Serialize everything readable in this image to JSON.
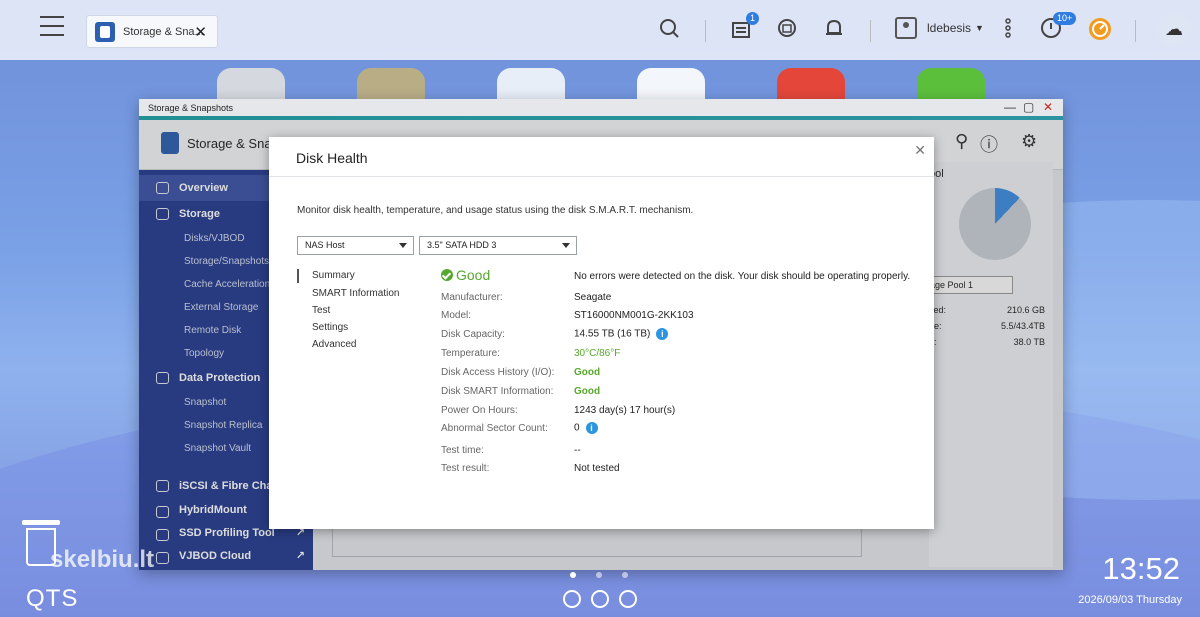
{
  "topbar": {
    "task_tab_label": "Storage & Sna...",
    "notification_count": "1",
    "events_count": "10+",
    "user_name": "ldebesis"
  },
  "window": {
    "title": "Storage & Snapshots",
    "app_title": "Storage & Snapshots"
  },
  "sidebar": {
    "overview": "Overview",
    "storage": "Storage",
    "storage_items": [
      "Disks/VJBOD",
      "Storage/Snapshots",
      "Cache Acceleration",
      "External Storage",
      "Remote Disk",
      "Topology"
    ],
    "data_protection": "Data Protection",
    "protection_items": [
      "Snapshot",
      "Snapshot Replica",
      "Snapshot Vault"
    ],
    "iscsi": "iSCSI & Fibre Channel",
    "hybridmount": "HybridMount",
    "ssd_profiling": "SSD Profiling Tool",
    "vjbod_cloud": "VJBOD Cloud"
  },
  "right_panel": {
    "title": "ool",
    "pool_select": "age Pool 1",
    "rows": [
      {
        "label": "ved:",
        "value": "210.6 GB"
      },
      {
        "label": "ne:",
        "value": "5.5/43.4TB"
      },
      {
        "label": "e:",
        "value": "38.0 TB"
      }
    ],
    "used_fraction": 0.12
  },
  "dialog": {
    "title": "Disk Health",
    "description": "Monitor disk health, temperature, and usage status using the disk S.M.A.R.T. mechanism.",
    "host_select": "NAS Host",
    "disk_select": "3.5\" SATA HDD 3",
    "nav": [
      "Summary",
      "SMART Information",
      "Test",
      "Settings",
      "Advanced"
    ],
    "status": "Good",
    "status_message": "No errors were detected on the disk. Your disk should be operating properly.",
    "fields": {
      "manufacturer_label": "Manufacturer:",
      "manufacturer": "Seagate",
      "model_label": "Model:",
      "model": "ST16000NM001G-2KK103",
      "capacity_label": "Disk Capacity:",
      "capacity": "14.55 TB (16 TB)",
      "temperature_label": "Temperature:",
      "temperature": "30°C/86°F",
      "access_history_label": "Disk Access History (I/O):",
      "access_history": "Good",
      "smart_label": "Disk SMART Information:",
      "smart": "Good",
      "power_on_label": "Power On Hours:",
      "power_on": "1243 day(s) 17 hour(s)",
      "abnormal_label": "Abnormal Sector Count:",
      "abnormal": "0",
      "test_time_label": "Test time:",
      "test_time": "--",
      "test_result_label": "Test result:",
      "test_result": "Not tested"
    }
  },
  "desktop": {
    "qts_label": "QTS",
    "watermark": "skelbiu.lt",
    "time": "13:52",
    "date": "2026/09/03 Thursday"
  }
}
